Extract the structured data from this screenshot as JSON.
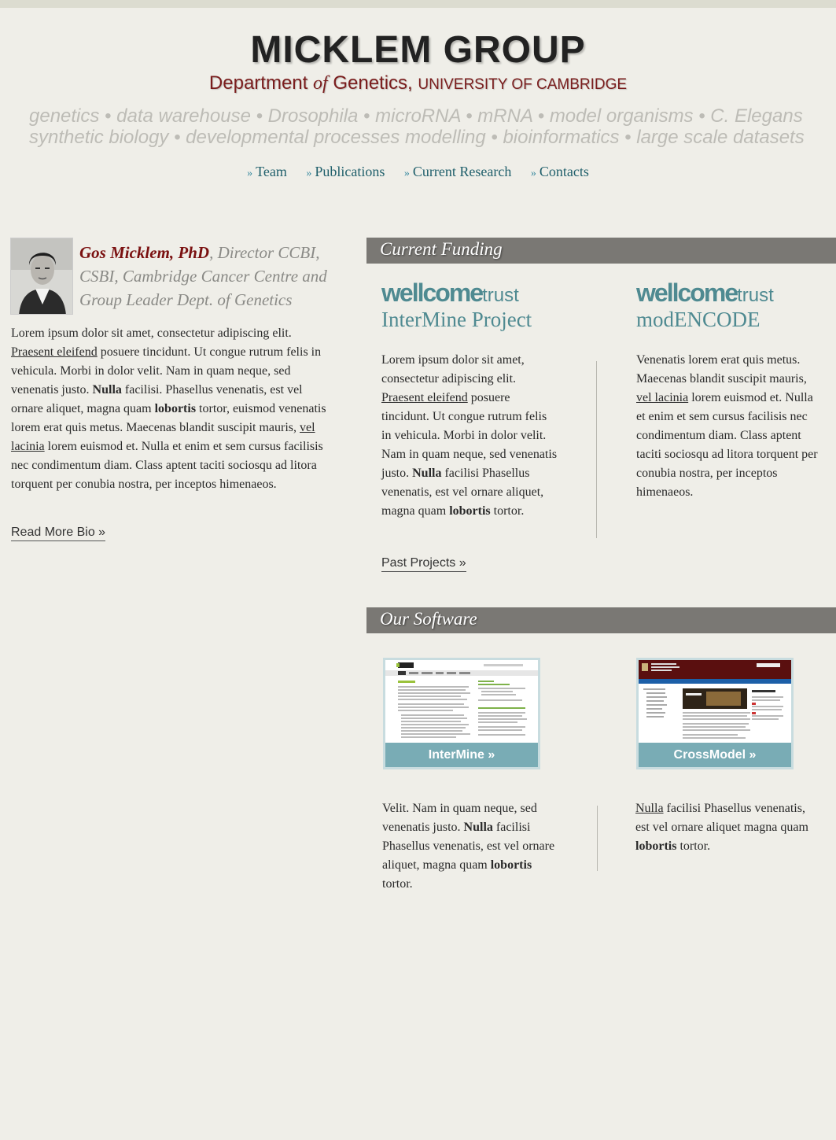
{
  "header": {
    "title": "MICKLEM GROUP",
    "dept_prefix": "Department",
    "dept_of": "of",
    "dept_name": "Genetics,",
    "university": "UNIVERSITY OF CAMBRIDGE",
    "keywords_line1": "genetics • data warehouse • Drosophila • microRNA • mRNA • model organisms • C. Elegans",
    "keywords_line2": "synthetic biology • developmental processes modelling • bioinformatics • large scale datasets"
  },
  "nav": {
    "marker": "»",
    "items": [
      "Team",
      "Publications",
      "Current Research",
      "Contacts"
    ]
  },
  "bio": {
    "name": "Gos Micklem, PhD",
    "role": ", Director CCBI, CSBI, Cambridge Cancer Centre and Group Leader Dept. of Genetics",
    "p1": "Lorem ipsum dolor sit amet, consectetur adipiscing elit. ",
    "link1": "Praesent eleifend",
    "p2": " posuere tincidunt. Ut congue rutrum felis in vehicula. Morbi in dolor velit. Nam in quam neque, sed venenatis justo. ",
    "bold1": "Nulla",
    "p3": " facilisi. Phasellus venenatis, est vel ornare aliquet, magna quam ",
    "bold2": "lobortis",
    "p4": " tortor, euismod venenatis lorem erat quis metus. Maecenas blandit suscipit mauris, ",
    "link2": "vel lacinia",
    "p5": " lorem euismod et. Nulla et enim et sem cursus facilisis nec condimentum diam. Class aptent taciti sociosqu ad litora torquent per conubia nostra, per inceptos himenaeos.",
    "read_more": "Read More Bio »"
  },
  "funding": {
    "heading": "Current Funding",
    "logo_word": "wellcome",
    "logo_trust": "trust",
    "left": {
      "project": "InterMine Project",
      "p1": "Lorem ipsum dolor sit amet, consectetur adipiscing elit. ",
      "link": "Praesent eleifend",
      "p2": " posuere tincidunt. Ut congue rutrum felis in vehicula. Morbi in dolor velit. Nam in quam neque, sed venenatis justo. ",
      "bold1": "Nulla",
      "p3": " facilisi Phasellus venenatis, est vel ornare aliquet, magna quam ",
      "bold2": "lobortis",
      "p4": " tortor."
    },
    "right": {
      "project": "modENCODE",
      "p1": "Venenatis lorem erat quis metus. Maecenas blandit suscipit mauris, ",
      "link": "vel lacinia",
      "p2": " lorem euismod et. Nulla et enim et sem cursus facilisis nec condimentum diam. Class aptent taciti sociosqu ad litora torquent per conubia nostra, per inceptos himenaeos."
    },
    "past_projects": "Past Projects »"
  },
  "software": {
    "heading": "Our Software",
    "intermine_label": "InterMine »",
    "crossmodel_label": "CrossModel »",
    "left": {
      "p1": "Velit. Nam in quam neque, sed venenatis justo. ",
      "bold1": "Nulla",
      "p2": " facilisi Phasellus venenatis, est vel ornare aliquet, magna quam ",
      "bold2": "lobortis",
      "p3": " tortor."
    },
    "right": {
      "link": "Nulla",
      "p1": " facilisi Phasellus venenatis, est vel ornare aliquet magna quam ",
      "bold": "lobortis",
      "p2": " tortor."
    }
  },
  "colors": {
    "accent_red": "#7a1d1d",
    "teal": "#4f8a91",
    "bar_gray": "#7a7874",
    "background": "#efeee8"
  }
}
